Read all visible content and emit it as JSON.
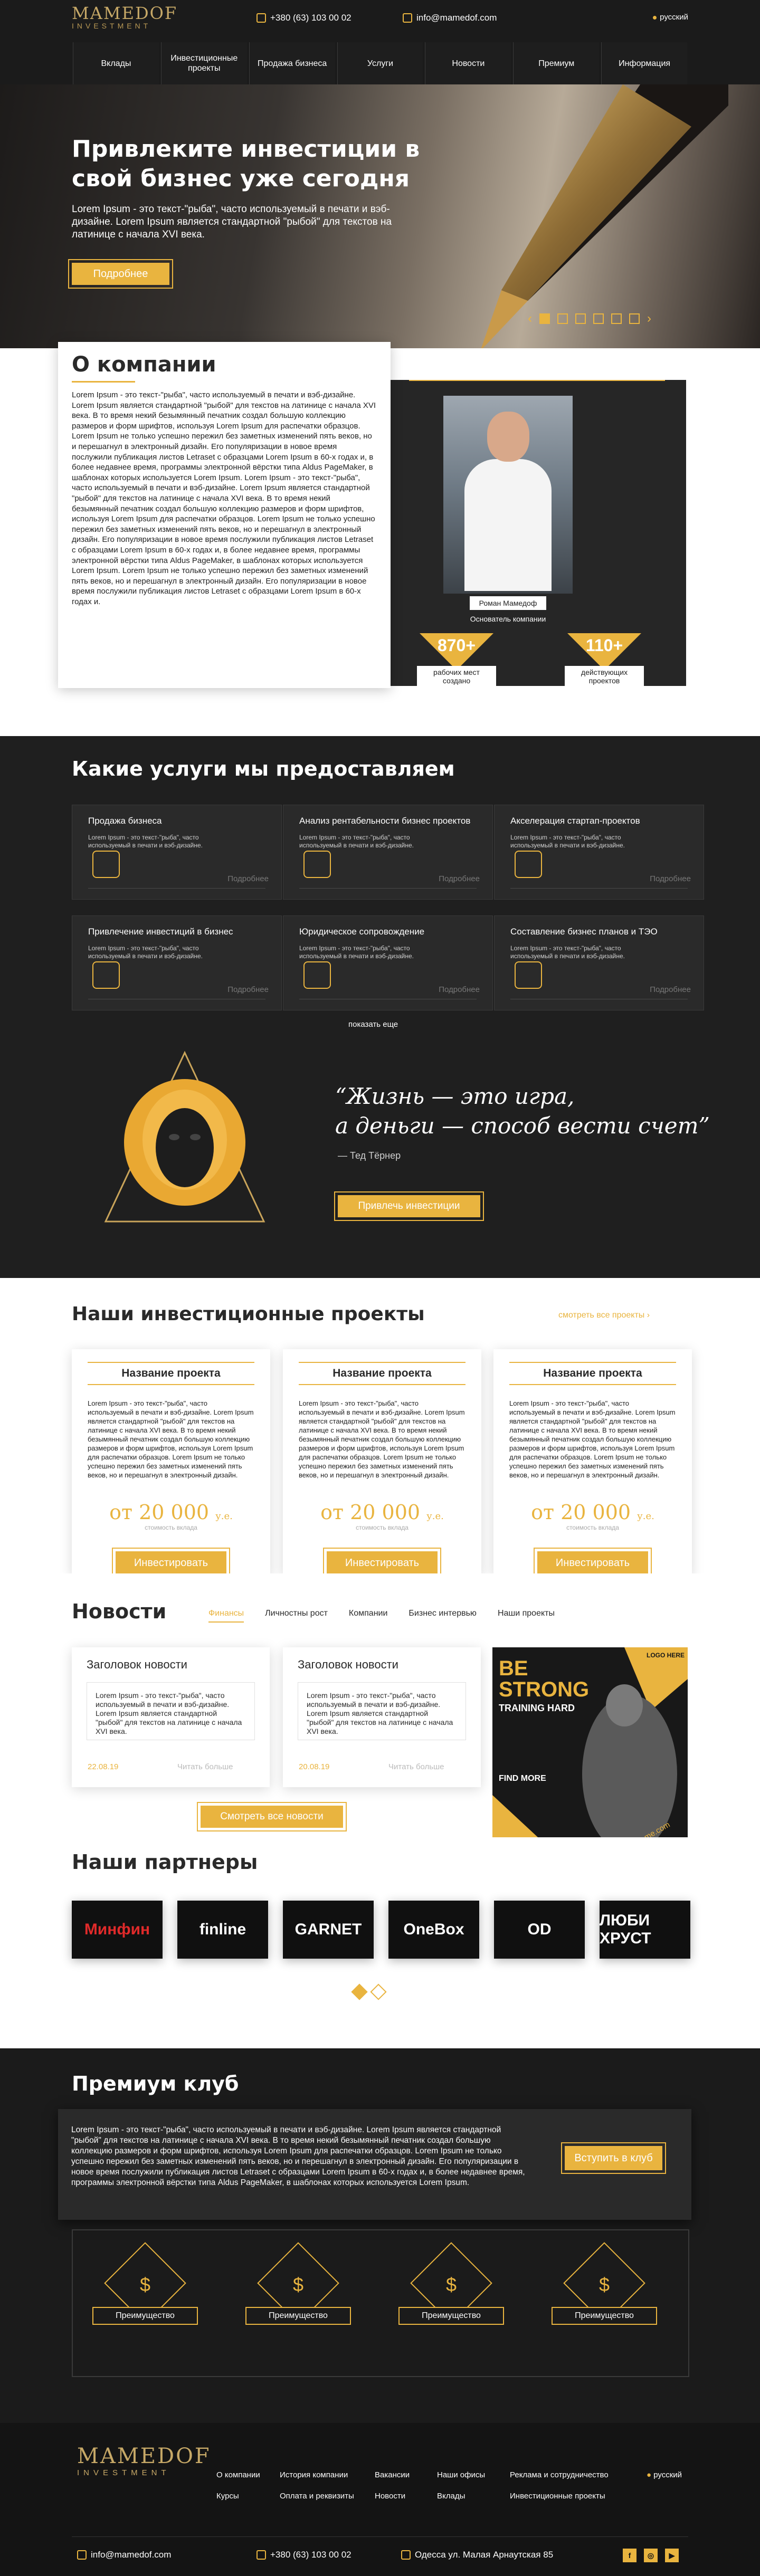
{
  "header": {
    "logo_title": "MAMEDOF",
    "logo_subtitle": "INVESTMENT",
    "phone": "+380 (63) 103 00 02",
    "email": "info@mamedof.com",
    "lang": "русский",
    "nav": [
      "Вклады",
      "Инвестиционные проекты",
      "Продажа бизнеса",
      "Услуги",
      "Новости",
      "Премиум",
      "Информация"
    ]
  },
  "hero": {
    "title": "Привлеките инвестиции в свой бизнес уже сегодня",
    "text": "Lorem Ipsum - это текст-\"рыба\", часто используемый в печати и вэб-дизайне. Lorem Ipsum является стандартной \"рыбой\" для текстов на латинице с начала XVI века.",
    "button": "Подробнее",
    "slides_total": 6,
    "slide_active": 1
  },
  "about": {
    "title": "О компании",
    "text": "Lorem Ipsum - это текст-\"рыба\", часто используемый в печати и вэб-дизайне. Lorem Ipsum является стандартной \"рыбой\" для текстов на латинице с начала XVI века. В то время некий безымянный печатник создал большую коллекцию размеров и форм шрифтов, используя Lorem Ipsum для распечатки образцов. Lorem Ipsum не только успешно пережил без заметных изменений пять веков, но и перешагнул в электронный дизайн. Его популяризации в новое время послужили публикация листов Letraset с образцами Lorem Ipsum в 60-х годах и, в более недавнее время, программы электронной вёрстки типа Aldus PageMaker, в шаблонах которых используется Lorem Ipsum. Lorem Ipsum - это текст-\"рыба\", часто используемый в печати и вэб-дизайне. Lorem Ipsum является стандартной \"рыбой\" для текстов на латинице с начала XVI века. В то время некий безымянный печатник создал большую коллекцию размеров и форм шрифтов, используя Lorem Ipsum для распечатки образцов. Lorem Ipsum не только успешно пережил без заметных изменений пять веков, но и перешагнул в электронный дизайн. Его популяризации в новое время послужили публикация листов Letraset с образцами Lorem Ipsum в 60-х годах и, в более недавнее время, программы электронной вёрстки типа Aldus PageMaker, в шаблонах которых используется Lorem Ipsum. Lorem Ipsum не только успешно пережил без заметных изменений пять веков, но и перешагнул в электронный дизайн. Его популяризации в новое время послужили публикация листов Letraset с образцами Lorem Ipsum в 60-х годах и.",
    "person_name": "Роман Мамедоф",
    "person_role": "Основатель компании",
    "stats": [
      {
        "value": "870+",
        "label": "рабочих мест создано"
      },
      {
        "value": "110+",
        "label": "действующих проектов"
      }
    ]
  },
  "services": {
    "title": "Какие услуги мы предоставляем",
    "items": [
      {
        "title": "Продажа бизнеса",
        "desc": "Lorem Ipsum - это текст-\"рыба\", часто используемый в печати и вэб-дизайне.",
        "more": "Подробнее"
      },
      {
        "title": "Анализ рентабельности бизнес проектов",
        "desc": "Lorem Ipsum - это текст-\"рыба\", часто используемый в печати и вэб-дизайне.",
        "more": "Подробнее"
      },
      {
        "title": "Акселерация стартап-проектов",
        "desc": "Lorem Ipsum - это текст-\"рыба\", часто используемый в печати и вэб-дизайне.",
        "more": "Подробнее"
      },
      {
        "title": "Привлечение инвестиций в бизнес",
        "desc": "Lorem Ipsum - это текст-\"рыба\", часто используемый в печати и вэб-дизайне.",
        "more": "Подробнее"
      },
      {
        "title": "Юридическое сопровождение",
        "desc": "Lorem Ipsum - это текст-\"рыба\", часто используемый в печати и вэб-дизайне.",
        "more": "Подробнее"
      },
      {
        "title": "Составление бизнес планов и ТЭО",
        "desc": "Lorem Ipsum - это текст-\"рыба\", часто используемый в печати и вэб-дизайне.",
        "more": "Подробнее"
      }
    ],
    "show_more": "показать еще",
    "quote_line1": "“Жизнь — это игра,",
    "quote_line2": "а деньги — способ вести счет”",
    "quote_author": "Тед Тёрнер",
    "button": "Привлечь инвестиции"
  },
  "projects": {
    "title": "Наши инвестиционные проекты",
    "see_all": "смотреть все проекты",
    "items": [
      {
        "title": "Название проекта",
        "desc": "Lorem Ipsum - это текст-\"рыба\", часто используемый в печати и вэб-дизайне. Lorem Ipsum является стандартной \"рыбой\" для текстов на латинице с начала XVI века. В то время некий безымянный печатник создал большую коллекцию размеров и форм шрифтов, используя Lorem Ipsum для распечатки образцов. Lorem Ipsum не только успешно пережил без заметных изменений пять веков, но и перешагнул в электронный дизайн.",
        "price": "от 20 000",
        "currency": "у.е.",
        "price_label": "стоимость вклада",
        "button": "Инвестировать"
      },
      {
        "title": "Название проекта",
        "desc": "Lorem Ipsum - это текст-\"рыба\", часто используемый в печати и вэб-дизайне. Lorem Ipsum является стандартной \"рыбой\" для текстов на латинице с начала XVI века. В то время некий безымянный печатник создал большую коллекцию размеров и форм шрифтов, используя Lorem Ipsum для распечатки образцов. Lorem Ipsum не только успешно пережил без заметных изменений пять веков, но и перешагнул в электронный дизайн.",
        "price": "от 20 000",
        "currency": "у.е.",
        "price_label": "стоимость вклада",
        "button": "Инвестировать"
      },
      {
        "title": "Название проекта",
        "desc": "Lorem Ipsum - это текст-\"рыба\", часто используемый в печати и вэб-дизайне. Lorem Ipsum является стандартной \"рыбой\" для текстов на латинице с начала XVI века. В то время некий безымянный печатник создал большую коллекцию размеров и форм шрифтов, используя Lorem Ipsum для распечатки образцов. Lorem Ipsum не только успешно пережил без заметных изменений пять веков, но и перешагнул в электронный дизайн.",
        "price": "от 20 000",
        "currency": "у.е.",
        "price_label": "стоимость вклада",
        "button": "Инвестировать"
      }
    ]
  },
  "news": {
    "title": "Новости",
    "tabs": [
      "Финансы",
      "Личностны рост",
      "Компании",
      "Бизнес интервью",
      "Наши проекты"
    ],
    "items": [
      {
        "title": "Заголовок новости",
        "text": "Lorem Ipsum - это текст-\"рыба\", часто используемый в печати и вэб-дизайне. Lorem Ipsum является стандартной \"рыбой\" для текстов на латинице с начала XVI века.",
        "date": "22.08.19",
        "more": "Читать больше"
      },
      {
        "title": "Заголовок новости",
        "text": "Lorem Ipsum - это текст-\"рыба\", часто используемый в печати и вэб-дизайне. Lorem Ipsum является стандартной \"рыбой\" для текстов на латинице с начала XVI века.",
        "date": "20.08.19",
        "more": "Читать больше"
      }
    ],
    "ad": {
      "l1": "BE",
      "l2": "STRONG",
      "l3": "TRAINING HARD",
      "logo": "LOGO HERE",
      "cta": "FIND MORE",
      "url": "www.gymname.com"
    },
    "button": "Смотреть все новости"
  },
  "partners": {
    "title": "Наши партнеры",
    "items": [
      "Минфин",
      "finline",
      "GARNET",
      "OneBox",
      "OD",
      "ЛЮБИ ХРУСТ"
    ],
    "slides_total": 2,
    "slide_active": 1
  },
  "premium": {
    "title": "Премиум клуб",
    "text": "Lorem Ipsum - это текст-\"рыба\", часто используемый в печати и вэб-дизайне. Lorem Ipsum является стандартной \"рыбой\" для текстов на латинице с начала XVI века. В то время некий безымянный печатник создал большую коллекцию размеров и форм шрифтов, используя Lorem Ipsum для распечатки образцов. Lorem Ipsum не только успешно пережил без заметных изменений пять веков, но и перешагнул в электронный дизайн. Его популяризации в новое время послужили публикация листов Letraset с образцами Lorem Ipsum в 60-х годах и, в более недавнее время, программы электронной вёрстки типа Aldus PageMaker, в шаблонах которых используется Lorem Ipsum.",
    "button": "Вступить в клуб",
    "perks": [
      "Преимущество",
      "Преимущество",
      "Преимущество",
      "Преимущество"
    ]
  },
  "footer": {
    "logo_title": "MAMEDOF",
    "logo_subtitle": "INVESTMENT",
    "links_row1": [
      "О компании",
      "История компании",
      "Вакансии",
      "Наши офисы",
      "Реклама и сотрудничество"
    ],
    "links_row2": [
      "Курсы",
      "Оплата и реквизиты",
      "Новости",
      "Вклады",
      "Инвестиционные проекты"
    ],
    "lang": "русский",
    "email": "info@mamedof.com",
    "phone": "+380 (63) 103 00 02",
    "address": "Одесса ул. Малая Арнаутская 85",
    "social": [
      "f",
      "◎",
      "▶"
    ]
  },
  "colors": {
    "accent": "#e9b43f",
    "dark": "#1b1b1b"
  }
}
